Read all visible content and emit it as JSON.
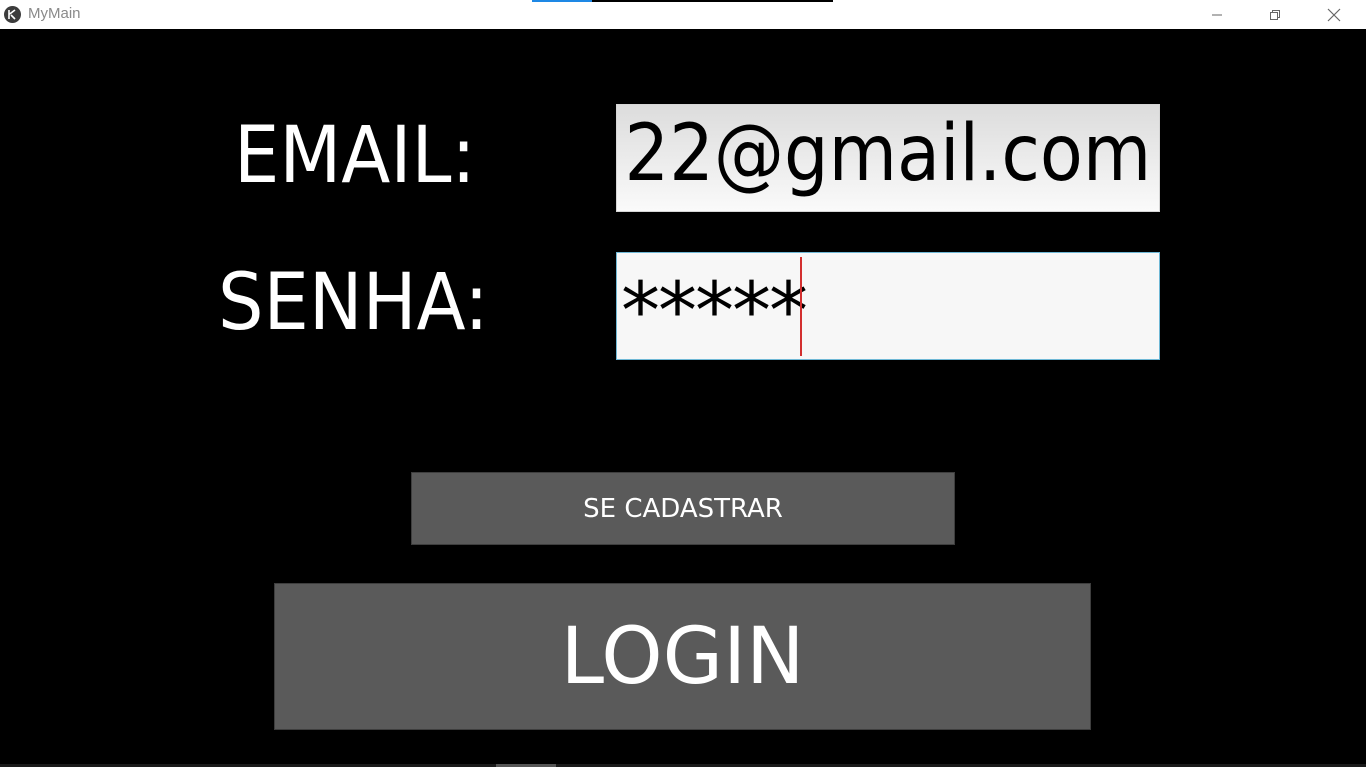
{
  "window": {
    "title": "MyMain",
    "app_icon": "kivy-logo-icon",
    "loading_progress": 0.2,
    "colors": {
      "accent": "#1e88e5",
      "titlebar_bg": "#ffffff",
      "title_text": "#8a8a8a"
    },
    "controls": [
      "minimize-icon",
      "restore-icon",
      "close-icon"
    ]
  },
  "form": {
    "email_label": "EMAIL:",
    "email_value": "22@gmail.com",
    "senha_label": "SENHA:",
    "senha_value": "*****",
    "cursor_color": "#d32f2f",
    "focus_border_color": "#6fb8d6"
  },
  "buttons": {
    "cadastrar_label": "SE CADASTRAR",
    "login_label": "LOGIN",
    "button_color": "#5a5a5a"
  }
}
